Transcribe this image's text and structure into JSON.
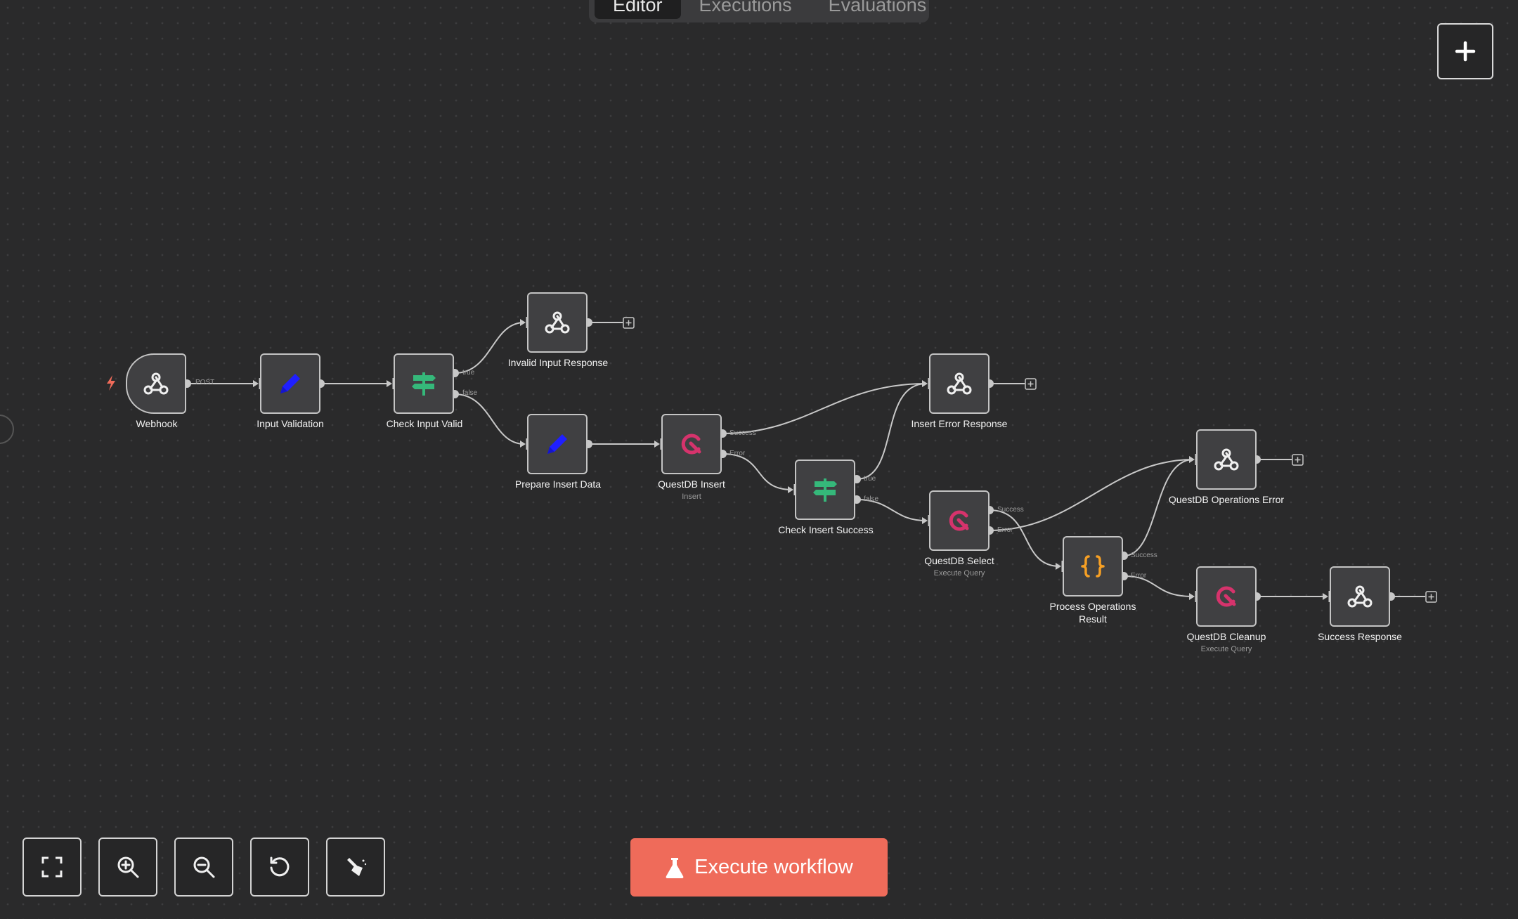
{
  "tabs": [
    {
      "label": "Editor",
      "active": true
    },
    {
      "label": "Executions",
      "active": false
    },
    {
      "label": "Evaluations",
      "active": false
    }
  ],
  "toolbar": {
    "execute_label": "Execute workflow",
    "controls": [
      "fit-view-icon",
      "zoom-in-icon",
      "zoom-out-icon",
      "reset-zoom-icon",
      "tidy-up-icon"
    ]
  },
  "colors": {
    "canvas": "#2a2a2b",
    "node_bg": "#404042",
    "edge": "#c8c8c8",
    "execute": "#ef6b5a",
    "if_green": "#35b87a",
    "questdb": "#d6336c",
    "set_blue": "#1f1fff",
    "code_orange": "#f59f24",
    "trigger": "#ef6b5a"
  },
  "nodes": {
    "webhook": {
      "label": "Webhook",
      "icon": "webhook-icon",
      "port_label": "POST"
    },
    "input_validation": {
      "label": "Input Validation",
      "icon": "pencil-icon"
    },
    "check_input_valid": {
      "label": "Check Input Valid",
      "icon": "if-signpost-icon",
      "ports": [
        "true",
        "false"
      ]
    },
    "invalid_input_response": {
      "label": "Invalid Input Response",
      "icon": "webhook-icon"
    },
    "prepare_insert_data": {
      "label": "Prepare Insert Data",
      "icon": "pencil-icon"
    },
    "questdb_insert": {
      "label": "QuestDB Insert",
      "sublabel": "Insert",
      "icon": "questdb-icon",
      "ports": [
        "Success",
        "Error"
      ]
    },
    "check_insert_success": {
      "label": "Check Insert Success",
      "icon": "if-signpost-icon",
      "ports": [
        "true",
        "false"
      ]
    },
    "insert_error_response": {
      "label": "Insert Error Response",
      "icon": "webhook-icon"
    },
    "questdb_select": {
      "label": "QuestDB Select",
      "sublabel": "Execute Query",
      "icon": "questdb-icon",
      "ports": [
        "Success",
        "Error"
      ]
    },
    "process_operations_result": {
      "label_line1": "Process Operations",
      "label_line2": "Result",
      "icon": "code-braces-icon",
      "ports": [
        "Success",
        "Error"
      ]
    },
    "questdb_operations_error": {
      "label": "QuestDB Operations Error",
      "icon": "webhook-icon"
    },
    "questdb_cleanup": {
      "label": "QuestDB Cleanup",
      "sublabel": "Execute Query",
      "icon": "questdb-icon"
    },
    "success_response": {
      "label": "Success Response",
      "icon": "webhook-icon"
    }
  }
}
